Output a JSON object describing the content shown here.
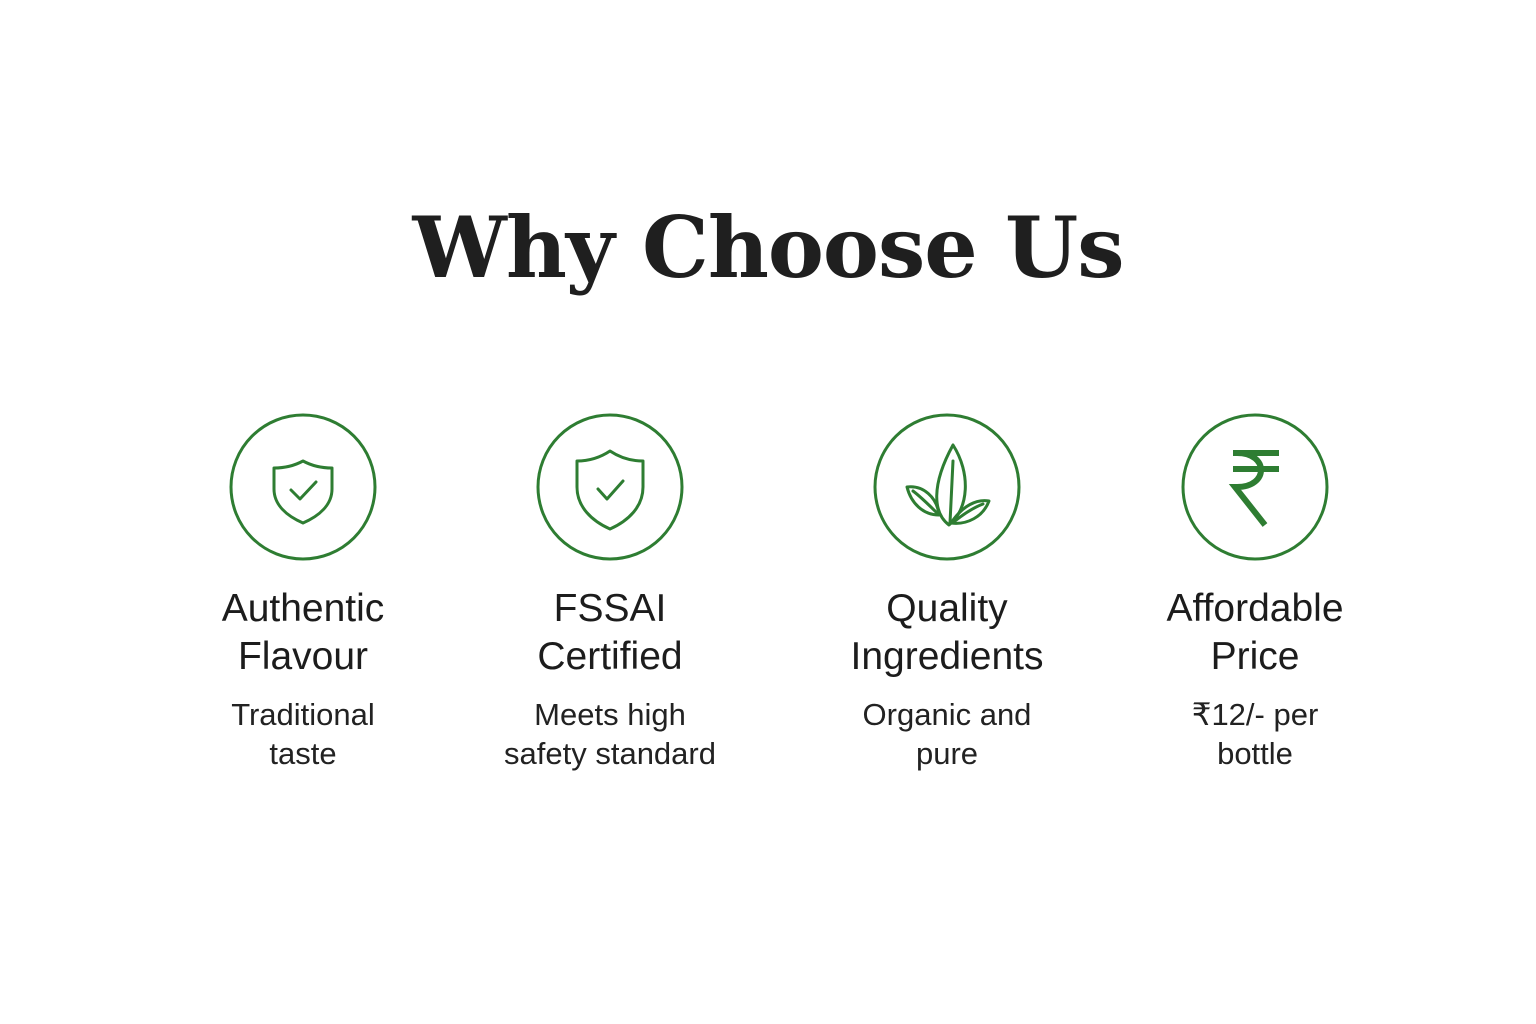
{
  "page": {
    "title": "Why Choose Us"
  },
  "colors": {
    "accent": "#2e7d32",
    "text": "#1f1f1f"
  },
  "features": [
    {
      "icon": "shield-check-icon",
      "title_line1": "Authentic",
      "title_line2": "Flavour",
      "desc_line1": "Traditional",
      "desc_line2": "taste"
    },
    {
      "icon": "shield-check-icon",
      "title_line1": "FSSAI",
      "title_line2": "Certified",
      "desc_line1": "Meets high",
      "desc_line2": "safety standard"
    },
    {
      "icon": "leaf-sprout-icon",
      "title_line1": "Quality",
      "title_line2": "Ingredients",
      "desc_line1": "Organic and",
      "desc_line2": "pure"
    },
    {
      "icon": "rupee-icon",
      "title_line1": "Affordable",
      "title_line2": "Price",
      "desc_line1": "₹12/- per",
      "desc_line2": "bottle"
    }
  ]
}
